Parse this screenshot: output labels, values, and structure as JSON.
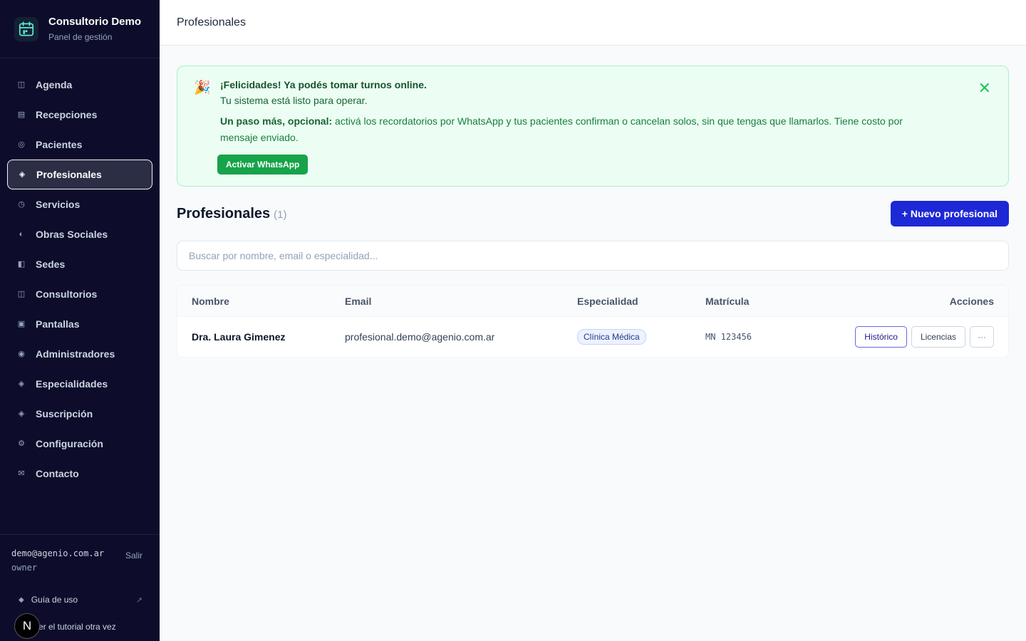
{
  "brand": {
    "title": "Consultorio Demo",
    "subtitle": "Panel de gestión"
  },
  "sidebar": {
    "items": [
      {
        "label": "Agenda",
        "icon": "◫"
      },
      {
        "label": "Recepciones",
        "icon": "▤"
      },
      {
        "label": "Pacientes",
        "icon": "◎"
      },
      {
        "label": "Profesionales",
        "icon": "◈",
        "active": true
      },
      {
        "label": "Servicios",
        "icon": "◷"
      },
      {
        "label": "Obras Sociales",
        "icon": "◐"
      },
      {
        "label": "Sedes",
        "icon": "◧"
      },
      {
        "label": "Consultorios",
        "icon": "◫"
      },
      {
        "label": "Pantallas",
        "icon": "▣"
      },
      {
        "label": "Administradores",
        "icon": "◉"
      },
      {
        "label": "Especialidades",
        "icon": "◈"
      },
      {
        "label": "Suscripción",
        "icon": "◈"
      },
      {
        "label": "Configuración",
        "icon": "⚙"
      },
      {
        "label": "Contacto",
        "icon": "✉"
      }
    ],
    "user_email": "demo@agenio.com.ar",
    "user_role": "owner",
    "logout": "Salir",
    "guide": "Guía de uso",
    "tutorial": "er el tutorial otra vez",
    "badge": "N"
  },
  "topbar": {
    "title": "Profesionales"
  },
  "banner": {
    "emoji": "🎉",
    "title": "¡Felicidades! Ya podés tomar turnos online.",
    "subtitle": "Tu sistema está listo para operar.",
    "body_bold": "Un paso más, opcional:",
    "body_text": " activá los recordatorios por WhatsApp y tus pacientes confirman o cancelan solos, sin que tengas que llamarlos. Tiene costo por mensaje enviado.",
    "button": "Activar WhatsApp",
    "close": "✕"
  },
  "section": {
    "title": "Profesionales",
    "count": "(1)",
    "new_button": "+ Nuevo profesional"
  },
  "search": {
    "placeholder": "Buscar por nombre, email o especialidad..."
  },
  "table": {
    "headers": [
      "Nombre",
      "Email",
      "Especialidad",
      "Matrícula",
      "Acciones"
    ],
    "rows": [
      {
        "name": "Dra. Laura Gimenez",
        "email": "profesional.demo@agenio.com.ar",
        "specialty": "Clínica Médica",
        "license": "MN 123456",
        "actions": [
          "Histórico",
          "Licencias",
          "···"
        ]
      }
    ]
  }
}
